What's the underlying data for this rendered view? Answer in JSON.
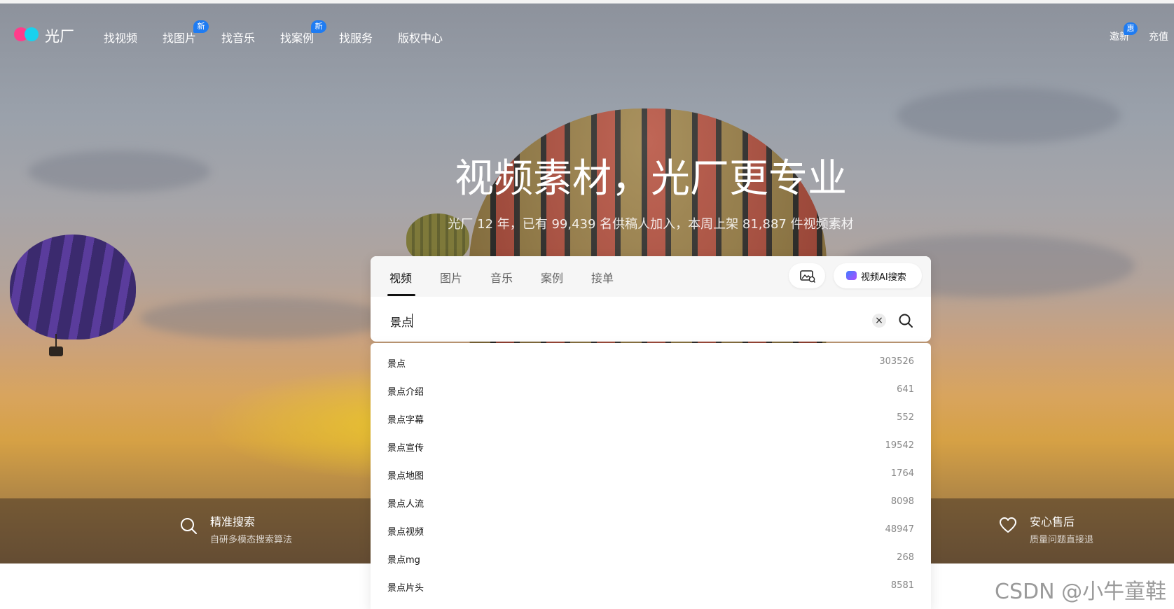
{
  "brand": {
    "name": "光厂"
  },
  "nav": [
    {
      "label": "找视频",
      "badge": ""
    },
    {
      "label": "找图片",
      "badge": "新"
    },
    {
      "label": "找音乐",
      "badge": ""
    },
    {
      "label": "找案例",
      "badge": "新"
    },
    {
      "label": "找服务",
      "badge": ""
    },
    {
      "label": "版权中心",
      "badge": ""
    }
  ],
  "header_right": {
    "invite_label": "邀新",
    "invite_badge": "惠",
    "recharge_label": "充值"
  },
  "hero": {
    "title": "视频素材，光厂更专业",
    "subtitle": "光厂 12 年，已有 99,439 名供稿人加入，本周上架 81,887 件视频素材"
  },
  "search": {
    "tabs": [
      "视频",
      "图片",
      "音乐",
      "案例",
      "接单"
    ],
    "active_tab": "视频",
    "ai_button_label": "视频AI搜索",
    "image_search_icon": "image-search-icon",
    "query": "景点",
    "clear_icon": "×"
  },
  "suggestions": [
    {
      "term": "景点",
      "count": "303526"
    },
    {
      "term": "景点介绍",
      "count": "641"
    },
    {
      "term": "景点字幕",
      "count": "552"
    },
    {
      "term": "景点宣传",
      "count": "19542"
    },
    {
      "term": "景点地图",
      "count": "1764"
    },
    {
      "term": "景点人流",
      "count": "8098"
    },
    {
      "term": "景点视频",
      "count": "48947"
    },
    {
      "term": "景点mg",
      "count": "268"
    },
    {
      "term": "景点片头",
      "count": "8581"
    }
  ],
  "features": [
    {
      "title": "精准搜索",
      "desc": "自研多模态搜索算法",
      "icon": "search-icon"
    },
    {
      "title": "安心售后",
      "desc": "质量问题直接退",
      "icon": "heart-icon"
    }
  ],
  "watermark": "CSDN @小牛童鞋",
  "colors": {
    "accent": "#1f7cf2",
    "logo_pink": "#ff3d8b",
    "logo_cyan": "#18d2ee"
  }
}
